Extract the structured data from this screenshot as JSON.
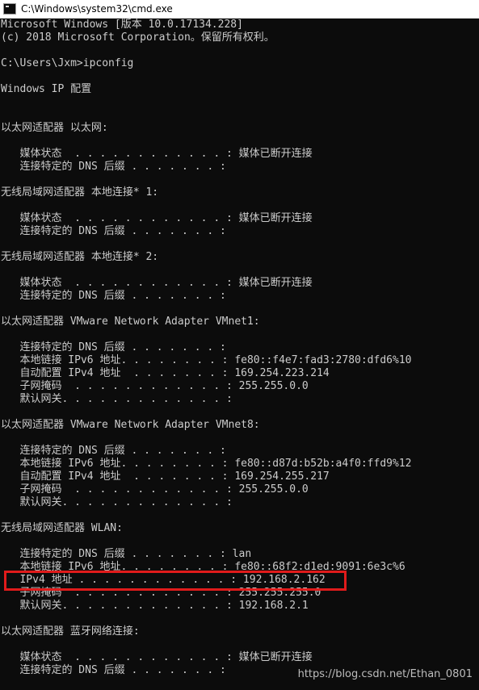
{
  "window": {
    "title": "C:\\Windows\\system32\\cmd.exe",
    "icon": "cmd-icon",
    "background": "#0c0c0c",
    "foreground": "#cccccc",
    "highlight_color": "#e01b1b"
  },
  "console": {
    "lines": [
      "Microsoft Windows [版本 10.0.17134.228]",
      "(c) 2018 Microsoft Corporation。保留所有权利。",
      "",
      "C:\\Users\\Jxm>ipconfig",
      "",
      "Windows IP 配置",
      "",
      "",
      "以太网适配器 以太网:",
      "",
      "   媒体状态  . . . . . . . . . . . . : 媒体已断开连接",
      "   连接特定的 DNS 后缀 . . . . . . . :",
      "",
      "无线局域网适配器 本地连接* 1:",
      "",
      "   媒体状态  . . . . . . . . . . . . : 媒体已断开连接",
      "   连接特定的 DNS 后缀 . . . . . . . :",
      "",
      "无线局域网适配器 本地连接* 2:",
      "",
      "   媒体状态  . . . . . . . . . . . . : 媒体已断开连接",
      "   连接特定的 DNS 后缀 . . . . . . . :",
      "",
      "以太网适配器 VMware Network Adapter VMnet1:",
      "",
      "   连接特定的 DNS 后缀 . . . . . . . :",
      "   本地链接 IPv6 地址. . . . . . . . : fe80::f4e7:fad3:2780:dfd6%10",
      "   自动配置 IPv4 地址  . . . . . . . : 169.254.223.214",
      "   子网掩码  . . . . . . . . . . . . : 255.255.0.0",
      "   默认网关. . . . . . . . . . . . . :",
      "",
      "以太网适配器 VMware Network Adapter VMnet8:",
      "",
      "   连接特定的 DNS 后缀 . . . . . . . :",
      "   本地链接 IPv6 地址. . . . . . . . : fe80::d87d:b52b:a4f0:ffd9%12",
      "   自动配置 IPv4 地址  . . . . . . . : 169.254.255.217",
      "   子网掩码  . . . . . . . . . . . . : 255.255.0.0",
      "   默认网关. . . . . . . . . . . . . :",
      "",
      "无线局域网适配器 WLAN:",
      "",
      "   连接特定的 DNS 后缀 . . . . . . . : lan",
      "   本地链接 IPv6 地址. . . . . . . . : fe80::68f2:d1ed:9091:6e3c%6",
      "   IPv4 地址 . . . . . . . . . . . . : 192.168.2.162",
      "   子网掩码  . . . . . . . . . . . . : 255.255.255.0",
      "   默认网关. . . . . . . . . . . . . : 192.168.2.1",
      "",
      "以太网适配器 蓝牙网络连接:",
      "",
      "   媒体状态  . . . . . . . . . . . . : 媒体已断开连接",
      "   连接特定的 DNS 后缀 . . . . . . . :"
    ]
  },
  "watermark": "https://blog.csdn.net/Ethan_0801"
}
